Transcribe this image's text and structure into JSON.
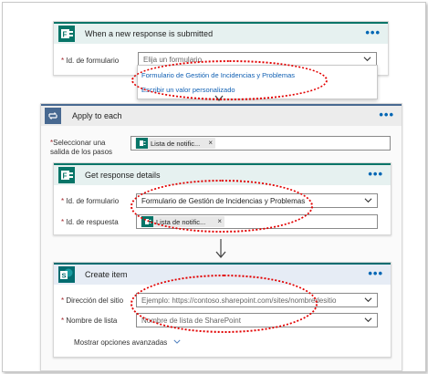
{
  "trigger": {
    "title": "When a new response is submitted",
    "menu": "•••",
    "field_label": "Id. de formulario",
    "field_placeholder": "Elija un formulario",
    "dropdown_items": [
      "Formulario de Gestión de Incidencias y Problemas",
      "Escribir un valor personalizado"
    ]
  },
  "apply_each": {
    "title": "Apply to each",
    "menu": "•••",
    "field_label_line1": "Seleccionar una",
    "field_label_line2": "salida de los pasos",
    "chip_text": "Lista de notific...",
    "chip_close": "×"
  },
  "get_response": {
    "title": "Get response details",
    "menu": "•••",
    "form_label": "Id. de formulario",
    "form_value": "Formulario de Gestión de Incidencias y Problemas",
    "response_label": "Id. de respuesta",
    "chip_text": "Lista de notific...",
    "chip_close": "×"
  },
  "create_item": {
    "title": "Create item",
    "menu": "•••",
    "site_label": "Dirección del sitio",
    "site_placeholder": "Ejemplo: https://contoso.sharepoint.com/sites/nombredesitio",
    "list_label": "Nombre de lista",
    "list_placeholder": "Nombre de lista de SharePoint",
    "advanced": "Mostrar opciones avanzadas"
  },
  "required_mark": "*",
  "colors": {
    "forms_green": "#077568",
    "sharepoint_teal": "#036c70",
    "apply_blue": "#486991",
    "annotation_red": "#e20000"
  }
}
